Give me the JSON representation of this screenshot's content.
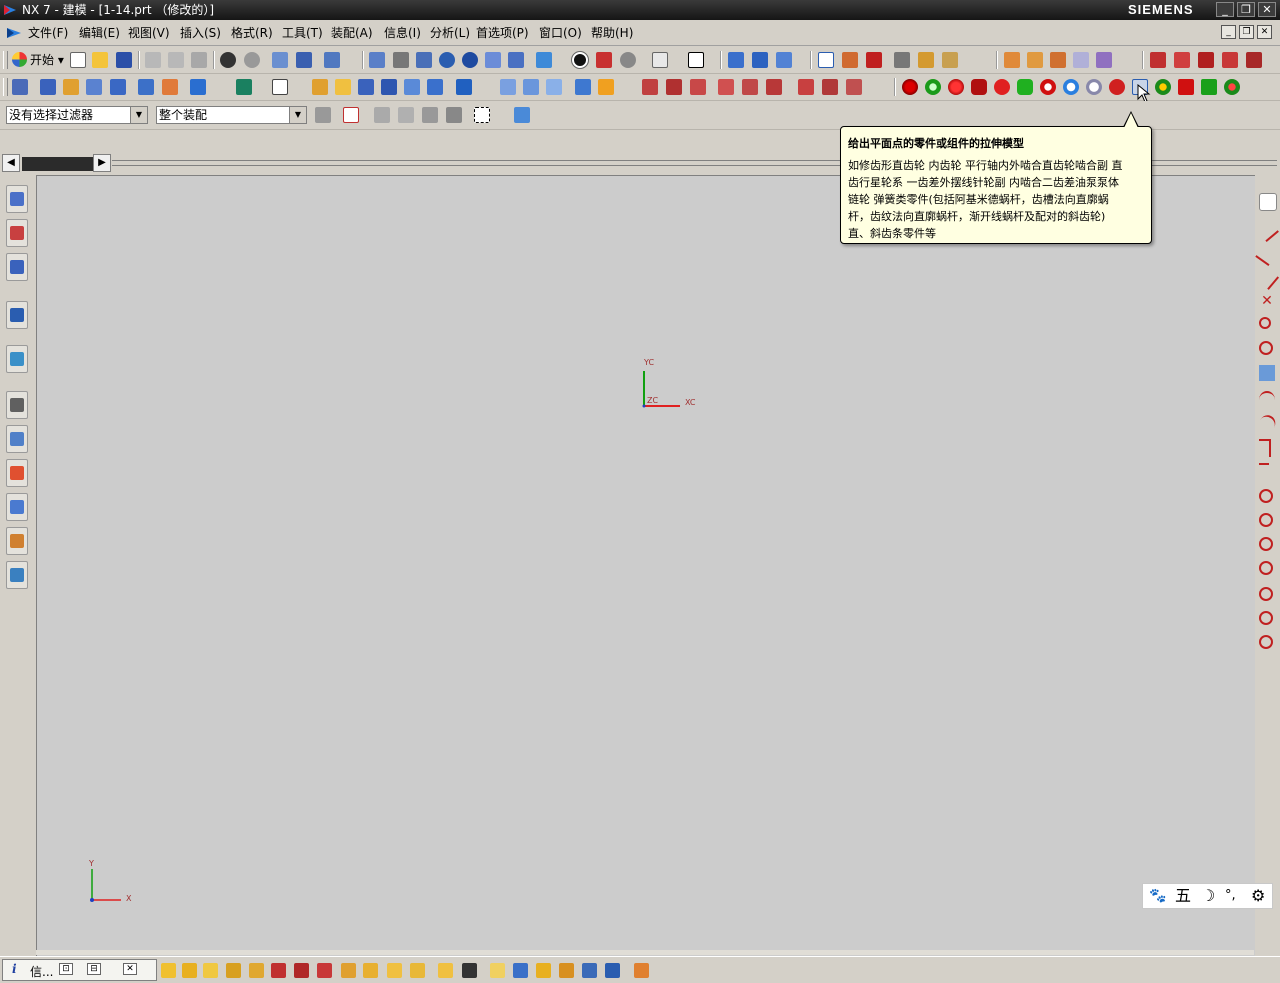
{
  "window": {
    "title": "NX 7 - 建模 - [1-14.prt （修改的）]",
    "brand": "SIEMENS",
    "controls": {
      "minimize": "_",
      "restore": "❐",
      "close": "✕"
    }
  },
  "menubar": {
    "items": [
      "文件(F)",
      "编辑(E)",
      "视图(V)",
      "插入(S)",
      "格式(R)",
      "工具(T)",
      "装配(A)",
      "信息(I)",
      "分析(L)",
      "首选项(P)",
      "窗口(O)",
      "帮助(H)"
    ],
    "mdi": {
      "minimize": "_",
      "restore": "❐",
      "close": "✕"
    }
  },
  "toolbar": {
    "start_label": "开始",
    "filter_value": "没有选择过滤器",
    "scope_value": "整个装配"
  },
  "tooltip": {
    "title": "给出平面点的零件或组件的拉伸模型",
    "lines": [
      "如修齿形直齿轮 内齿轮 平行轴内外啮合直齿轮啮合副 直",
      "齿行星轮系 一齿差外摆线针轮副 内啮合二齿差油泵泵体",
      "链轮 弹簧类零件(包括阿基米德蜗杆，齿槽法向直廓蜗",
      "杆，齿纹法向直廓蜗杆，渐开线蜗杆及配对的斜齿轮)",
      "直、斜齿条零件等"
    ]
  },
  "wcs": {
    "xc": "XC",
    "yc": "YC",
    "zc": "ZC"
  },
  "absolute_csys": {
    "x": "X",
    "y": "Y"
  },
  "ime": {
    "mode_char": "五",
    "moon": "☽",
    "dots": "°,",
    "gear": "⚙",
    "paw": "🐾"
  },
  "statusbar": {
    "task_label": "信...",
    "mini_buttons": [
      "⊡",
      "⊟",
      "✕"
    ]
  },
  "colors": {
    "accent": "#2a5db0",
    "axis_x": "#e02020",
    "axis_y": "#10a010",
    "tooltip_bg": "#ffffe1"
  }
}
